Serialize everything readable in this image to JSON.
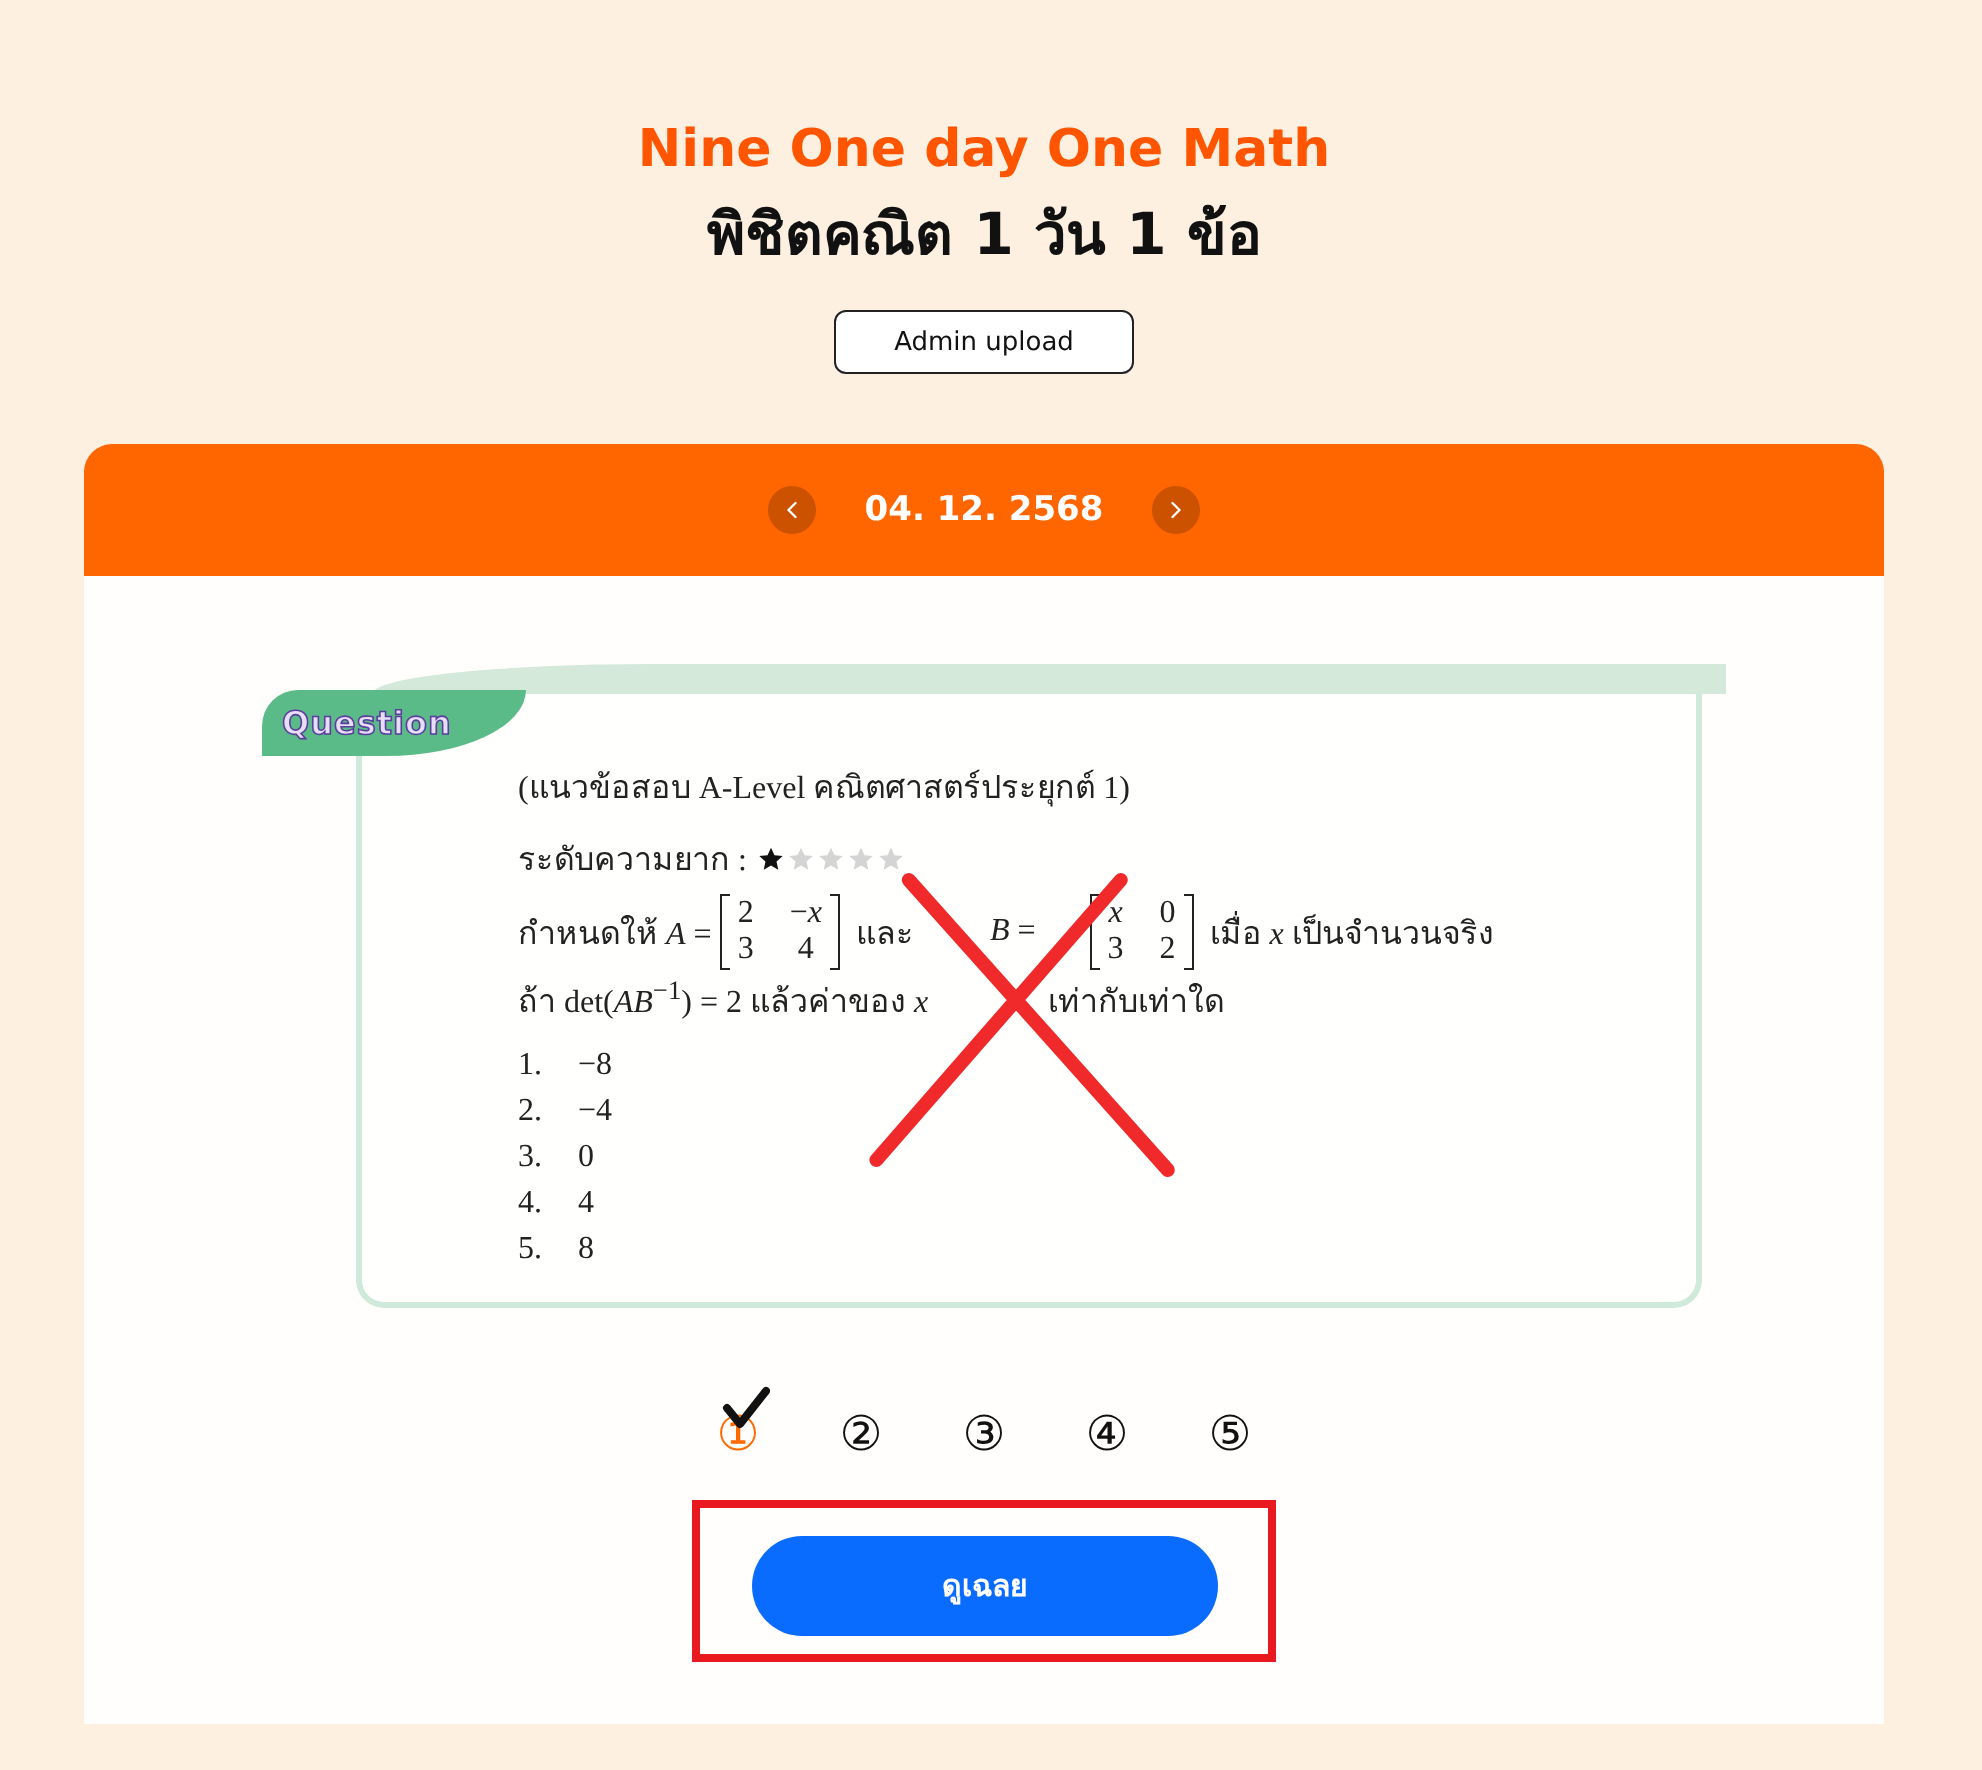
{
  "header": {
    "title": "Nine One day One Math",
    "subtitle": "พิชิตคณิต 1 วัน 1 ข้อ",
    "admin_button": "Admin upload"
  },
  "date_bar": {
    "date": "04. 12. 2568"
  },
  "question": {
    "badge": "Question",
    "source": "(แนวข้อสอบ A-Level คณิตศาสตร์ประยุกต์ 1)",
    "difficulty": {
      "label": "ระดับความยาก :",
      "stars": 1
    },
    "given": [
      {
        "kind": "text",
        "text": "กำหนดให้ *A* ="
      },
      {
        "kind": "matrix",
        "rows": [
          [
            "2",
            "−*x*"
          ],
          [
            "3",
            "4"
          ]
        ]
      },
      {
        "kind": "text",
        "text": "และ"
      },
      {
        "kind": "text",
        "text": "*B* ="
      },
      {
        "kind": "matrix",
        "rows": [
          [
            "*x*",
            "0"
          ],
          [
            "3",
            "2"
          ]
        ]
      },
      {
        "kind": "text",
        "text": "เมื่อ *x* เป็นจำนวนจริง"
      }
    ],
    "condition": [
      "ถ้า det(*AB*$^{−1}$) = 2 แล้วค่าของ *x*",
      "เท่ากับเท่าใด"
    ],
    "options": [
      {
        "number": "1.",
        "value": "−8"
      },
      {
        "number": "2.",
        "value": "−4"
      },
      {
        "number": "3.",
        "value": "0"
      },
      {
        "number": "4.",
        "value": "4"
      },
      {
        "number": "5.",
        "value": "8"
      }
    ]
  },
  "choices": [
    {
      "label": "①",
      "selected": true
    },
    {
      "label": "②",
      "selected": false
    },
    {
      "label": "③",
      "selected": false
    },
    {
      "label": "④",
      "selected": false
    },
    {
      "label": "⑤",
      "selected": false
    }
  ],
  "answer_button": "ดูเฉลย"
}
